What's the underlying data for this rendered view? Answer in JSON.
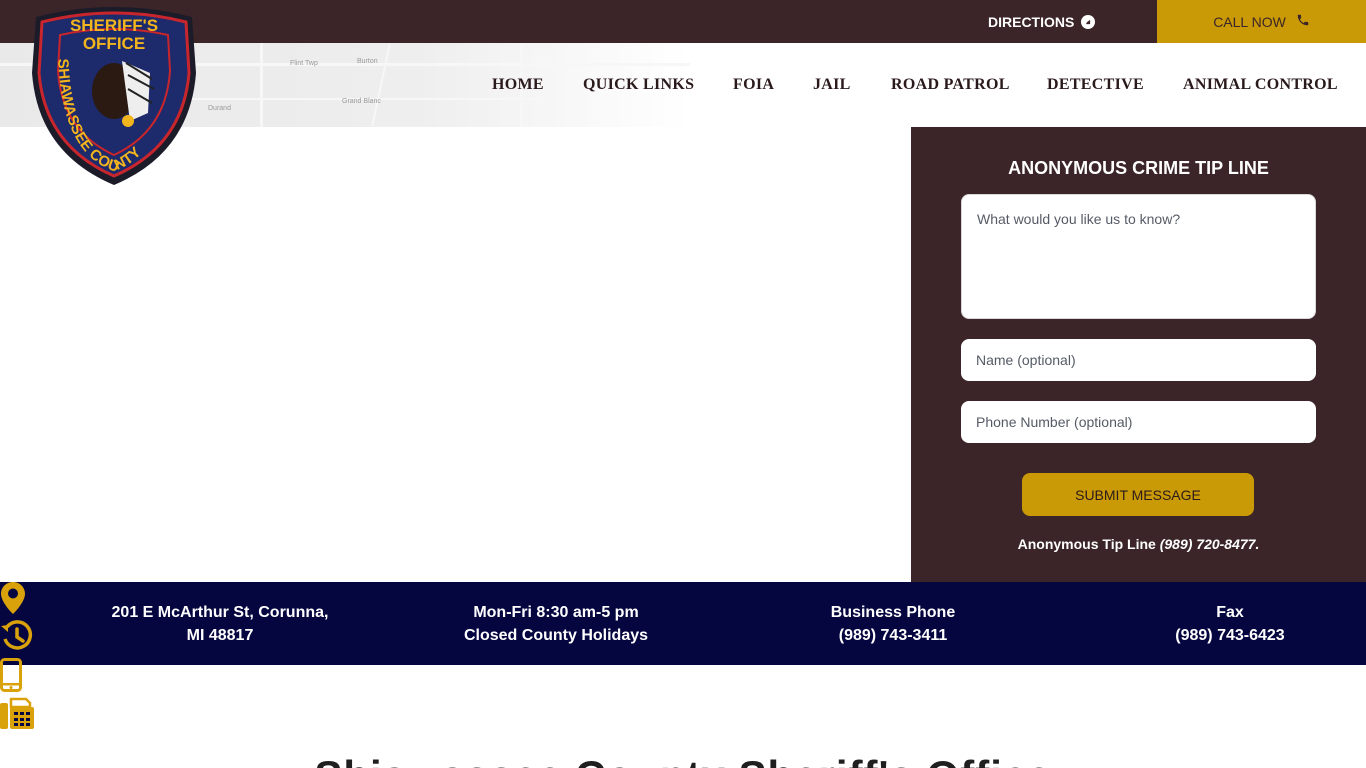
{
  "topbar": {
    "directions_label": "DIRECTIONS",
    "directions_icon": "compass-icon",
    "callnow_label": "CALL NOW",
    "callnow_icon": "phone-icon",
    "background_color": "#3b2528",
    "accent_color": "#c99a06"
  },
  "logo": {
    "text_top": "SHERIFF'S OFFICE",
    "text_ring": "SHIAWASSEE COUNTY"
  },
  "map": {
    "labels": [
      "Flint Twp",
      "Burton",
      "Grand Blanc",
      "Durand"
    ]
  },
  "nav": {
    "items": [
      {
        "label": "HOME"
      },
      {
        "label": "QUICK LINKS"
      },
      {
        "label": "FOIA"
      },
      {
        "label": "JAIL"
      },
      {
        "label": "ROAD PATROL"
      },
      {
        "label": "DETECTIVE"
      },
      {
        "label": "ANIMAL CONTROL"
      }
    ]
  },
  "tip_form": {
    "title": "ANONYMOUS CRIME TIP LINE",
    "message_placeholder": "What would you like us to know?",
    "name_placeholder": "Name (optional)",
    "phone_placeholder": "Phone Number (optional)",
    "submit_label": "SUBMIT MESSAGE",
    "footer_label": "Anonymous Tip Line",
    "footer_phone": "(989) 720-8477."
  },
  "info_bar": {
    "background_color": "#05063f",
    "items": [
      {
        "icon": "map-pin-icon",
        "line1": "201 E McArthur St, Corunna,",
        "line2": "MI 48817"
      },
      {
        "icon": "history-clock-icon",
        "line1": "Mon-Fri 8:30 am-5 pm",
        "line2": "Closed County Holidays"
      },
      {
        "icon": "mobile-phone-icon",
        "line1": "Business Phone",
        "line2": "(989) 743-3411"
      },
      {
        "icon": "fax-icon",
        "line1": "Fax",
        "line2": "(989) 743-6423"
      }
    ]
  },
  "bottom_heading": "Shiawassee County Sheriff's Office"
}
